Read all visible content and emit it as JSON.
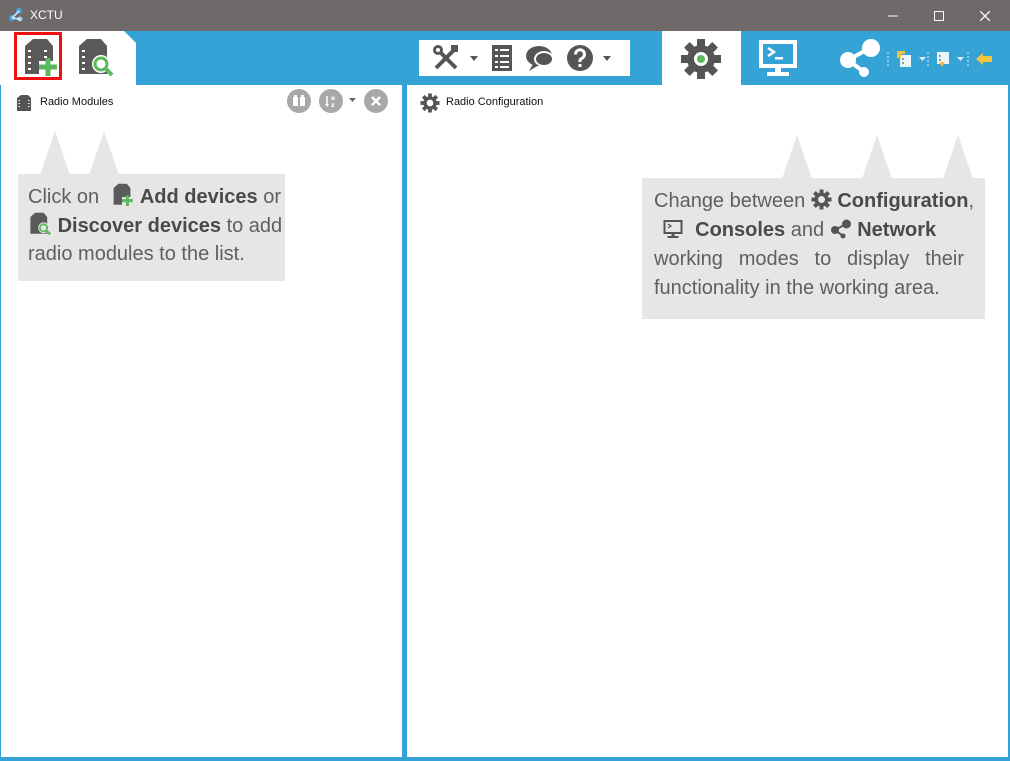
{
  "window": {
    "title": "XCTU"
  },
  "panels": {
    "left_title": "Radio Modules",
    "right_title": "Radio Configuration"
  },
  "hint_left": {
    "l1a": "Click on",
    "l1b": "Add devices",
    "l1c": "or",
    "l2a": "Discover devices",
    "l2b": "to add",
    "l3": "radio modules to the list."
  },
  "hint_right": {
    "l1a": "Change between",
    "l1b": "Configuration",
    "l1c": ",",
    "l2a": "Consoles",
    "l2b": "and",
    "l2c": "Network",
    "l3": "working modes to display their",
    "l4": "functionality in the working area."
  },
  "colors": {
    "accent": "#35a3d5",
    "hint_bg": "#e6e6e6",
    "highlight": "#ef1111",
    "add_green": "#5cb85c"
  }
}
